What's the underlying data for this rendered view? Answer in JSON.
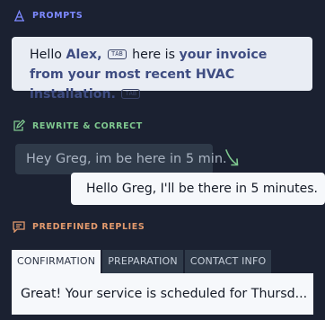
{
  "sections": {
    "prompts": {
      "title": "PROMPTS",
      "icon": "prompt-icon"
    },
    "rewrite": {
      "title": "REWRITE & CORRECT",
      "icon": "edit-icon"
    },
    "replies": {
      "title": "PREDEFINED REPLIES",
      "icon": "message-icon"
    }
  },
  "prompt": {
    "part1": "Hello ",
    "name": "Alex,",
    "tab_key_1": "TAB",
    "part2": " here is ",
    "highlight": "your invoice from your most recent HVAC installation.",
    "tab_key_2": "TAB"
  },
  "rewrite": {
    "before": "Hey Greg, im be here in 5 min.",
    "after": "Hello Greg, I'll be there in 5 minutes.",
    "arrow_icon": "arrow-down-right-icon"
  },
  "replies": {
    "tabs": [
      {
        "label": "CONFIRMATION",
        "active": true
      },
      {
        "label": "PREPARATION",
        "active": false
      },
      {
        "label": "CONTACT INFO",
        "active": false
      }
    ],
    "content": "Great! Your service is scheduled for Thursd..."
  },
  "colors": {
    "background": "#1b2131",
    "prompts_accent": "#7d89ff",
    "rewrite_accent": "#7fc88f",
    "replies_accent": "#e39a6d"
  }
}
